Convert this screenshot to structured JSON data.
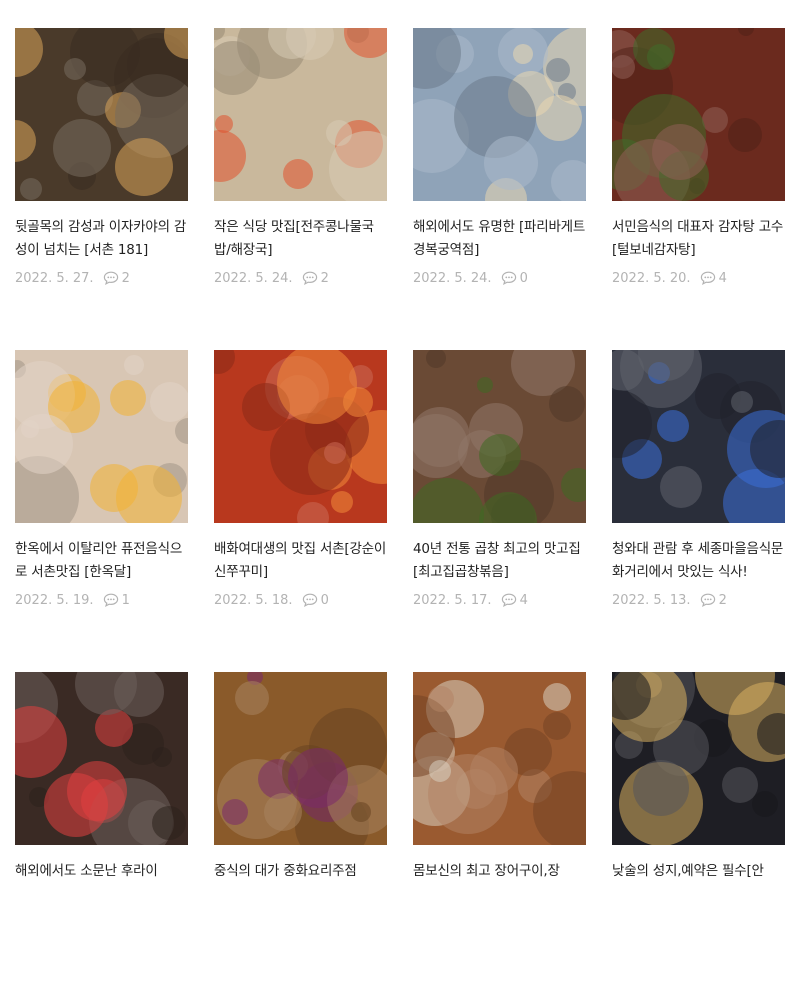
{
  "posts": [
    {
      "title": "뒷골목의 감성과 이자카야의 감성이 넘치는 [서촌 181]",
      "date": "2022. 5. 27.",
      "comments": "2",
      "thumb_desc": "izakaya-table-photo",
      "bg": "#4a3a2a",
      "accent": "#d9a45a"
    },
    {
      "title": "작은 식당 맛집[전주콩나물국밥/해장국]",
      "date": "2022. 5. 24.",
      "comments": "2",
      "thumb_desc": "spicy-stew-photo",
      "bg": "#c9b89c",
      "accent": "#e0522e"
    },
    {
      "title": "해외에서도 유명한 [파리바게트 경복궁역점]",
      "date": "2022. 5. 24.",
      "comments": "0",
      "thumb_desc": "bakery-shelf-photo",
      "bg": "#8fa3b8",
      "accent": "#e9d7b0"
    },
    {
      "title": "서민음식의 대표자 감자탕 고수 [털보네감자탕]",
      "date": "2022. 5. 20.",
      "comments": "4",
      "thumb_desc": "gamjatang-photo",
      "bg": "#6b2a1e",
      "accent": "#3f6b2a"
    },
    {
      "title": "한옥에서 이탈리안 퓨전음식으로 서촌맛집 [한옥달]",
      "date": "2022. 5. 19.",
      "comments": "1",
      "thumb_desc": "pasta-egg-photo",
      "bg": "#d8c6b4",
      "accent": "#f2b233"
    },
    {
      "title": "배화여대생의 맛집 서촌[강순이신쭈꾸미]",
      "date": "2022. 5. 18.",
      "comments": "0",
      "thumb_desc": "spicy-octopus-photo",
      "bg": "#b8381e",
      "accent": "#f28a3a"
    },
    {
      "title": "40년 전통 곱창 최고의 맛고집 [최고집곱창볶음]",
      "date": "2022. 5. 17.",
      "comments": "4",
      "thumb_desc": "gopchang-pan-photo",
      "bg": "#6a4a35",
      "accent": "#3e6a22"
    },
    {
      "title": "청와대 관람 후 세종마을음식문화거리에서 맛있는 식사!",
      "date": "2022. 5. 13.",
      "comments": "2",
      "thumb_desc": "food-street-photo",
      "bg": "#2a2e3a",
      "accent": "#3b6fd9"
    },
    {
      "title": "해외에서도 소문난 후라이",
      "date": "",
      "comments": "",
      "thumb_desc": "restaurant-storefront-photo",
      "bg": "#3a2a24",
      "accent": "#e04040"
    },
    {
      "title": "중식의 대가 중화요리주점",
      "date": "",
      "comments": "",
      "thumb_desc": "chinese-dish-photo",
      "bg": "#8a5a2a",
      "accent": "#7a2a6a"
    },
    {
      "title": "몸보신의 최고 장어구이,장",
      "date": "",
      "comments": "",
      "thumb_desc": "eel-restaurant-photo",
      "bg": "#9a5a30",
      "accent": "#d9d0c0"
    },
    {
      "title": "낮술의 성지,예약은 필수[안",
      "date": "",
      "comments": "",
      "thumb_desc": "night-alley-photo",
      "bg": "#1e1e24",
      "accent": "#d9b060"
    }
  ]
}
